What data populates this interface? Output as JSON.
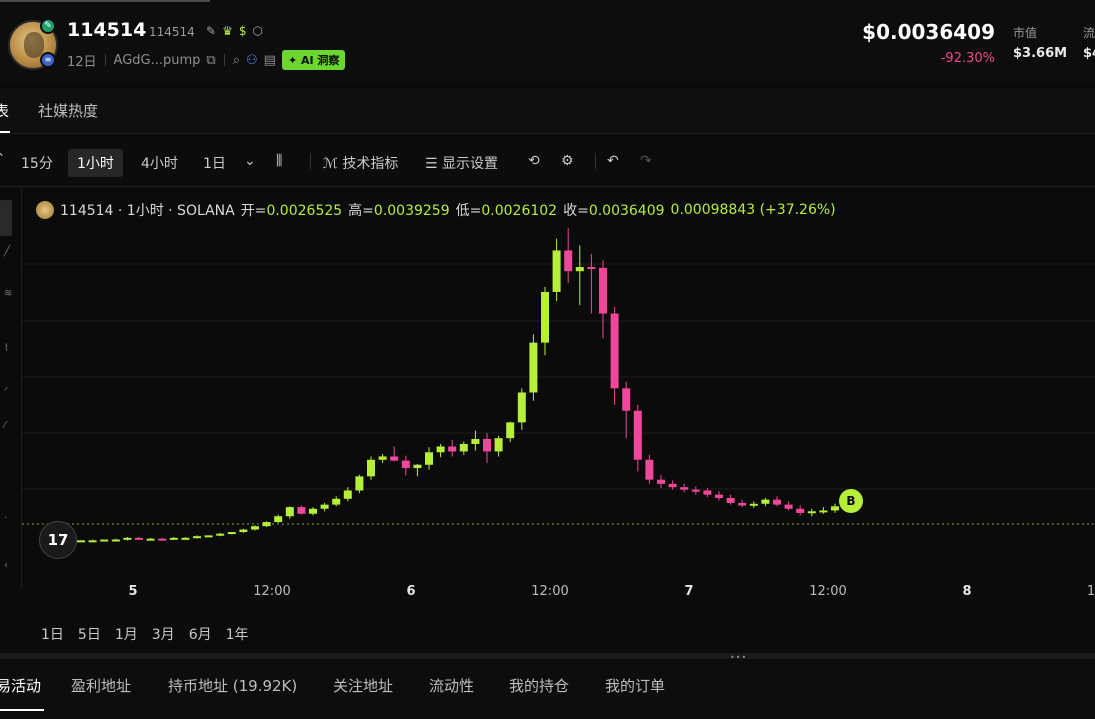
{
  "token": {
    "name": "114514",
    "symbol": "114514",
    "age": "12日",
    "address": "AGdG...pump",
    "ai_label": "AI 洞察",
    "price": "$0.0036409",
    "price_change": "-92.30%",
    "stats": [
      {
        "label": "市值",
        "value": "$3.66M"
      },
      {
        "label": "流",
        "value": "$4"
      }
    ]
  },
  "tabs": [
    {
      "label": "表"
    },
    {
      "label": "社媒热度"
    }
  ],
  "toolbar": {
    "intervals": [
      "15分",
      "1小时",
      "4小时",
      "1日"
    ],
    "active_interval": "1小时",
    "indicators": "技术指标",
    "display": "显示设置"
  },
  "legend": {
    "title": "114514 · 1小时 · SOLANA",
    "open_label": "开=",
    "open": "0.0026525",
    "high_label": "高=",
    "high": "0.0039259",
    "low_label": "低=",
    "low": "0.0026102",
    "close_label": "收=",
    "close": "0.0036409",
    "change": "0.00098843 (+37.26%)"
  },
  "chart_data": {
    "type": "candlestick",
    "x_ticks": [
      {
        "label": "5",
        "bold": true
      },
      {
        "label": "12:00",
        "bold": false
      },
      {
        "label": "6",
        "bold": true
      },
      {
        "label": "12:00",
        "bold": false
      },
      {
        "label": "7",
        "bold": true
      },
      {
        "label": "12:00",
        "bold": false
      },
      {
        "label": "8",
        "bold": true
      },
      {
        "label": "1",
        "bold": false
      }
    ],
    "up_color": "#b5ef3a",
    "down_color": "#f0479b",
    "candles": [
      [
        0.00016,
        0.00017,
        0.00015,
        0.00017
      ],
      [
        0.00017,
        0.00018,
        0.00016,
        0.00017
      ],
      [
        0.00017,
        0.00018,
        0.00016,
        0.00018
      ],
      [
        0.00018,
        0.00019,
        0.00017,
        0.00018
      ],
      [
        0.00018,
        0.00021,
        0.00017,
        0.0002
      ],
      [
        0.0002,
        0.00021,
        0.00018,
        0.00019
      ],
      [
        0.00019,
        0.0002,
        0.00018,
        0.00019
      ],
      [
        0.00019,
        0.0002,
        0.00018,
        0.00018
      ],
      [
        0.00018,
        0.00021,
        0.00018,
        0.0002
      ],
      [
        0.0002,
        0.00021,
        0.00019,
        0.0002
      ],
      [
        0.0002,
        0.00023,
        0.00019,
        0.00022
      ],
      [
        0.00022,
        0.00023,
        0.00021,
        0.00023
      ],
      [
        0.00023,
        0.00026,
        0.00022,
        0.00025
      ],
      [
        0.00025,
        0.00027,
        0.00024,
        0.00027
      ],
      [
        0.00027,
        0.00031,
        0.00026,
        0.0003
      ],
      [
        0.0003,
        0.00035,
        0.00029,
        0.00034
      ],
      [
        0.00034,
        0.0004,
        0.00033,
        0.00039
      ],
      [
        0.00039,
        0.00048,
        0.00038,
        0.00046
      ],
      [
        0.00046,
        0.00058,
        0.00043,
        0.00057
      ],
      [
        0.00057,
        0.00059,
        0.00048,
        0.00049
      ],
      [
        0.00049,
        0.00057,
        0.00047,
        0.00055
      ],
      [
        0.00055,
        0.00062,
        0.00052,
        0.0006
      ],
      [
        0.0006,
        0.0007,
        0.00058,
        0.00067
      ],
      [
        0.00067,
        0.00081,
        0.00064,
        0.00077
      ],
      [
        0.00077,
        0.00096,
        0.00074,
        0.00094
      ],
      [
        0.00094,
        0.00118,
        0.0009,
        0.00114
      ],
      [
        0.00114,
        0.00121,
        0.0011,
        0.00118
      ],
      [
        0.00118,
        0.0013,
        0.00112,
        0.00113
      ],
      [
        0.00113,
        0.00119,
        0.00095,
        0.00104
      ],
      [
        0.00104,
        0.00109,
        0.00094,
        0.00108
      ],
      [
        0.00108,
        0.00129,
        0.00102,
        0.00123
      ],
      [
        0.00123,
        0.00133,
        0.00117,
        0.0013
      ],
      [
        0.0013,
        0.00138,
        0.00118,
        0.00124
      ],
      [
        0.00124,
        0.00136,
        0.0012,
        0.00133
      ],
      [
        0.00133,
        0.00149,
        0.00125,
        0.00139
      ],
      [
        0.00139,
        0.00146,
        0.0011,
        0.00124
      ],
      [
        0.00124,
        0.00143,
        0.00118,
        0.0014
      ],
      [
        0.0014,
        0.0016,
        0.00135,
        0.00159
      ],
      [
        0.00159,
        0.002,
        0.0015,
        0.00195
      ],
      [
        0.00195,
        0.00265,
        0.00185,
        0.00255
      ],
      [
        0.00255,
        0.00322,
        0.0024,
        0.00316
      ],
      [
        0.00316,
        0.0038,
        0.00305,
        0.00366
      ],
      [
        0.00366,
        0.00393,
        0.00327,
        0.00341
      ],
      [
        0.00341,
        0.00372,
        0.003,
        0.00346
      ],
      [
        0.00346,
        0.00362,
        0.0029,
        0.00345
      ],
      [
        0.00345,
        0.00354,
        0.0026,
        0.0029
      ],
      [
        0.0029,
        0.00298,
        0.0018,
        0.002
      ],
      [
        0.002,
        0.00208,
        0.0014,
        0.00173
      ],
      [
        0.00173,
        0.0018,
        0.001,
        0.00114
      ],
      [
        0.00114,
        0.0012,
        0.00085,
        0.0009
      ],
      [
        0.0009,
        0.00096,
        0.0008,
        0.00085
      ],
      [
        0.00085,
        0.00089,
        0.00078,
        0.00081
      ],
      [
        0.00081,
        0.00085,
        0.00075,
        0.00078
      ],
      [
        0.00078,
        0.00082,
        0.00072,
        0.00077
      ],
      [
        0.00077,
        0.0008,
        0.00069,
        0.00072
      ],
      [
        0.00072,
        0.00076,
        0.00065,
        0.00068
      ],
      [
        0.00068,
        0.00072,
        0.0006,
        0.00062
      ],
      [
        0.00062,
        0.00066,
        0.00057,
        0.00059
      ],
      [
        0.00059,
        0.00064,
        0.00056,
        0.00061
      ],
      [
        0.00061,
        0.00068,
        0.00058,
        0.00066
      ],
      [
        0.00066,
        0.0007,
        0.00058,
        0.0006
      ],
      [
        0.0006,
        0.00064,
        0.00053,
        0.00055
      ],
      [
        0.00055,
        0.00059,
        0.00047,
        0.0005
      ],
      [
        0.0005,
        0.00055,
        0.00046,
        0.00052
      ],
      [
        0.00052,
        0.00057,
        0.00049,
        0.00053
      ],
      [
        0.00053,
        0.00061,
        0.0005,
        0.00058
      ]
    ],
    "marker_label": "B"
  },
  "ranges": [
    "1日",
    "5日",
    "1月",
    "3月",
    "6月",
    "1年"
  ],
  "bottom_tabs": [
    {
      "label": "易活动"
    },
    {
      "label": "盈利地址"
    },
    {
      "label": "持币地址 (19.92K)"
    },
    {
      "label": "关注地址"
    },
    {
      "label": "流动性"
    },
    {
      "label": "我的持仓"
    },
    {
      "label": "我的订单"
    }
  ],
  "tv_logo": "17"
}
